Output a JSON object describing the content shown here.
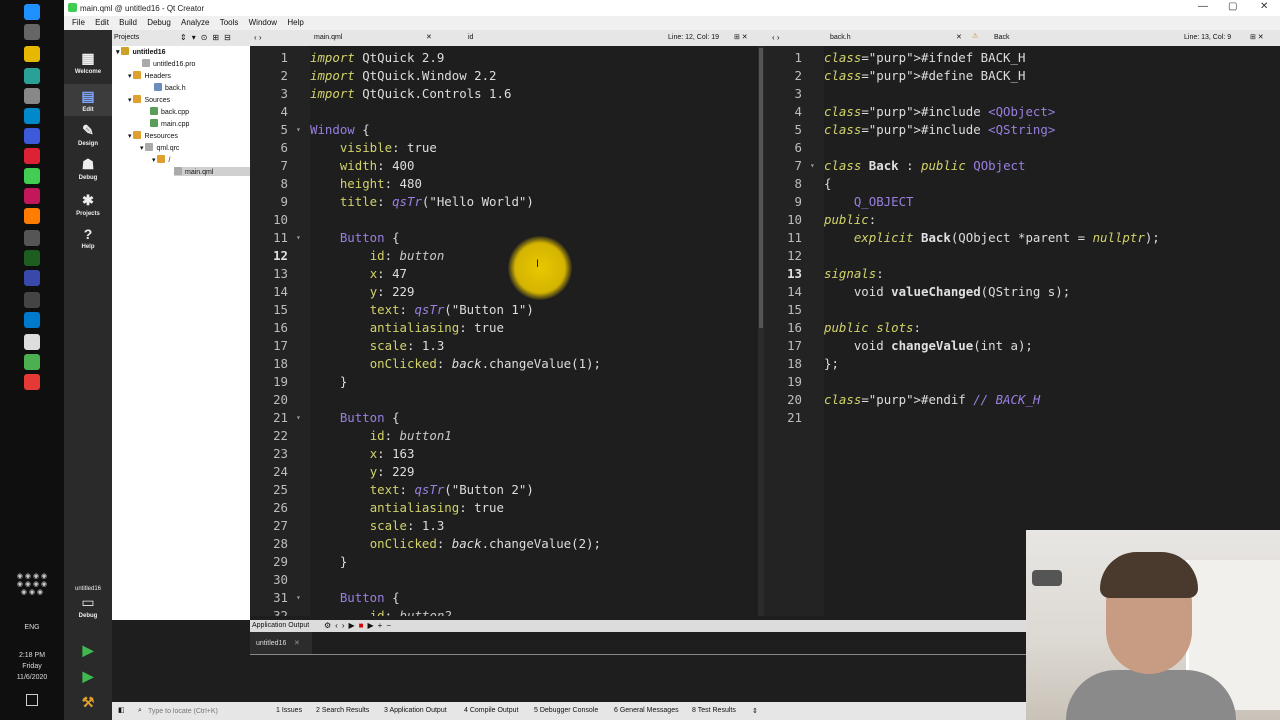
{
  "window": {
    "title": "main.qml @ untitled16 - Qt Creator"
  },
  "menu": [
    "File",
    "Edit",
    "Build",
    "Debug",
    "Analyze",
    "Tools",
    "Window",
    "Help"
  ],
  "modes": [
    {
      "label": "Welcome",
      "icon": "grid-icon"
    },
    {
      "label": "Edit",
      "icon": "edit-icon"
    },
    {
      "label": "Design",
      "icon": "pen-icon"
    },
    {
      "label": "Debug",
      "icon": "bug-icon"
    },
    {
      "label": "Projects",
      "icon": "wrench-icon"
    },
    {
      "label": "Help",
      "icon": "help-icon"
    }
  ],
  "kit": {
    "project": "untitled16",
    "mode": "Debug"
  },
  "projects": {
    "header": "Projects",
    "tree": [
      {
        "label": "untitled16",
        "bold": true
      },
      {
        "label": "untitled16.pro"
      },
      {
        "label": "Headers"
      },
      {
        "label": "back.h"
      },
      {
        "label": "Sources"
      },
      {
        "label": "back.cpp"
      },
      {
        "label": "main.cpp"
      },
      {
        "label": "Resources"
      },
      {
        "label": "qml.qrc"
      },
      {
        "label": "/"
      },
      {
        "label": "main.qml"
      }
    ]
  },
  "left_editor": {
    "file": "main.qml",
    "symbol": "id",
    "position": "Line: 12, Col: 19",
    "lines": [
      {
        "n": "1",
        "t": "import QtQuick 2.9"
      },
      {
        "n": "2",
        "t": "import QtQuick.Window 2.2"
      },
      {
        "n": "3",
        "t": "import QtQuick.Controls 1.6"
      },
      {
        "n": "4",
        "t": ""
      },
      {
        "n": "5",
        "t": "Window {"
      },
      {
        "n": "6",
        "t": "    visible: true"
      },
      {
        "n": "7",
        "t": "    width: 400"
      },
      {
        "n": "8",
        "t": "    height: 480"
      },
      {
        "n": "9",
        "t": "    title: qsTr(\"Hello World\")"
      },
      {
        "n": "10",
        "t": ""
      },
      {
        "n": "11",
        "t": "    Button {"
      },
      {
        "n": "12",
        "t": "        id: button"
      },
      {
        "n": "13",
        "t": "        x: 47"
      },
      {
        "n": "14",
        "t": "        y: 229"
      },
      {
        "n": "15",
        "t": "        text: qsTr(\"Button 1\")"
      },
      {
        "n": "16",
        "t": "        antialiasing: true"
      },
      {
        "n": "17",
        "t": "        scale: 1.3"
      },
      {
        "n": "18",
        "t": "        onClicked: back.changeValue(1);"
      },
      {
        "n": "19",
        "t": "    }"
      },
      {
        "n": "20",
        "t": ""
      },
      {
        "n": "21",
        "t": "    Button {"
      },
      {
        "n": "22",
        "t": "        id: button1"
      },
      {
        "n": "23",
        "t": "        x: 163"
      },
      {
        "n": "24",
        "t": "        y: 229"
      },
      {
        "n": "25",
        "t": "        text: qsTr(\"Button 2\")"
      },
      {
        "n": "26",
        "t": "        antialiasing: true"
      },
      {
        "n": "27",
        "t": "        scale: 1.3"
      },
      {
        "n": "28",
        "t": "        onClicked: back.changeValue(2);"
      },
      {
        "n": "29",
        "t": "    }"
      },
      {
        "n": "30",
        "t": ""
      },
      {
        "n": "31",
        "t": "    Button {"
      },
      {
        "n": "32",
        "t": "        id: button2"
      }
    ]
  },
  "right_editor": {
    "file": "back.h",
    "symbol": "Back",
    "position": "Line: 13, Col: 9",
    "lines": [
      {
        "n": "1",
        "t": "#ifndef BACK_H"
      },
      {
        "n": "2",
        "t": "#define BACK_H"
      },
      {
        "n": "3",
        "t": ""
      },
      {
        "n": "4",
        "t": "#include <QObject>"
      },
      {
        "n": "5",
        "t": "#include <QString>"
      },
      {
        "n": "6",
        "t": ""
      },
      {
        "n": "7",
        "t": "class Back : public QObject"
      },
      {
        "n": "8",
        "t": "{"
      },
      {
        "n": "9",
        "t": "    Q_OBJECT"
      },
      {
        "n": "10",
        "t": "public:"
      },
      {
        "n": "11",
        "t": "    explicit Back(QObject *parent = nullptr);"
      },
      {
        "n": "12",
        "t": ""
      },
      {
        "n": "13",
        "t": "signals:"
      },
      {
        "n": "14",
        "t": "    void valueChanged(QString s);"
      },
      {
        "n": "15",
        "t": ""
      },
      {
        "n": "16",
        "t": "public slots:"
      },
      {
        "n": "17",
        "t": "    void changeValue(int a);"
      },
      {
        "n": "18",
        "t": "};"
      },
      {
        "n": "19",
        "t": ""
      },
      {
        "n": "20",
        "t": "#endif // BACK_H"
      },
      {
        "n": "21",
        "t": ""
      }
    ]
  },
  "output": {
    "header": "Application Output",
    "tab": "untitled16"
  },
  "clock": {
    "time": "2:18 PM",
    "day": "Friday",
    "date": "11/6/2020",
    "lang": "ENG"
  },
  "statusbar": {
    "locate_placeholder": "Type to locate (Ctrl+K)",
    "panes": [
      "1 Issues",
      "2 Search Results",
      "3 Application Output",
      "4 Compile Output",
      "5 Debugger Console",
      "6 General Messages",
      "8 Test Results"
    ]
  }
}
